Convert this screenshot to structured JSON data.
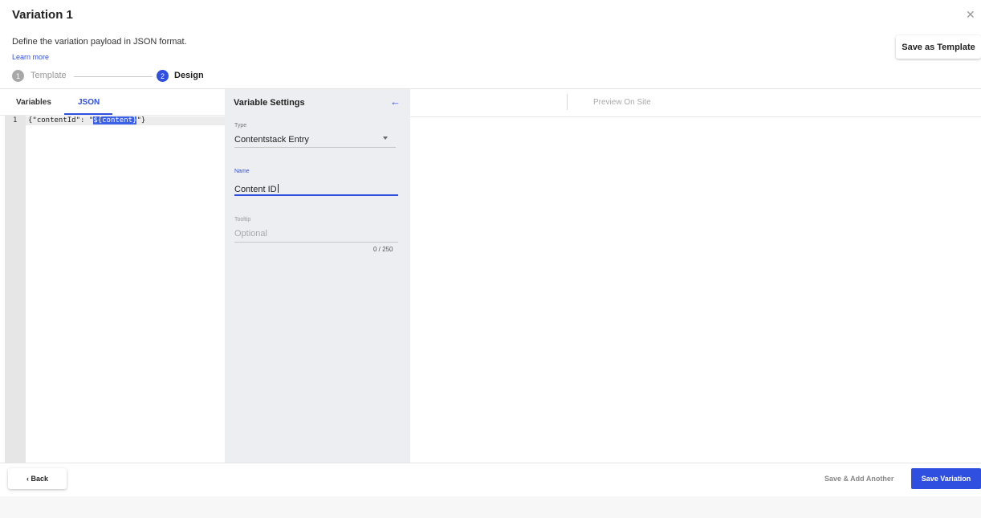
{
  "modal": {
    "title": "Variation 1",
    "close_icon": "close-icon",
    "description": "Define the variation payload in JSON format.",
    "learn_more": "Learn more",
    "save_as_template": "Save as Template"
  },
  "stepper": {
    "steps": [
      {
        "number": "1",
        "label": "Template",
        "active": false
      },
      {
        "number": "2",
        "label": "Design",
        "active": true
      }
    ]
  },
  "editor": {
    "tabs": [
      {
        "label": "Variables",
        "active": false
      },
      {
        "label": "JSON",
        "active": true
      }
    ],
    "lines": [
      {
        "number": "1",
        "before": "{\"contentId\": \"",
        "selected": "${content}",
        "after": "\"}"
      }
    ]
  },
  "variable_settings": {
    "title": "Variable Settings",
    "back_icon": "arrow-left-icon",
    "type": {
      "label": "Type",
      "value": "Contentstack Entry"
    },
    "name": {
      "label": "Name",
      "value": "Content ID"
    },
    "tooltip": {
      "label": "Tooltip",
      "placeholder": "Optional",
      "counter": "0 / 250"
    }
  },
  "preview": {
    "label": "Preview On Site"
  },
  "footer": {
    "back": "‹ Back",
    "save_add_another": "Save & Add Another",
    "save_variation": "Save Variation"
  },
  "colors": {
    "accent": "#2f4fe0",
    "panel_bg": "#eceef1",
    "gutter_bg": "#e6e6e6"
  }
}
